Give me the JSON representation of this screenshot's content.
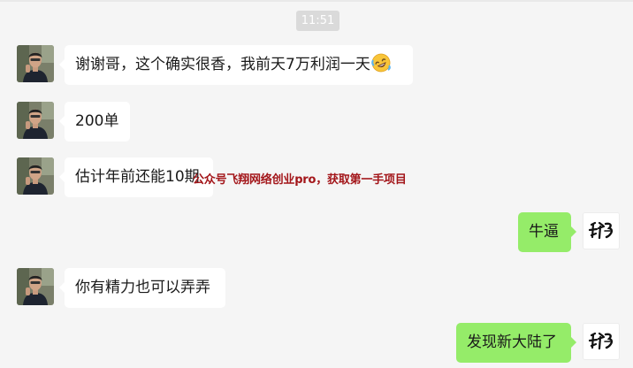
{
  "timestamp": "11:51",
  "messages": [
    {
      "side": "left",
      "text": "谢谢哥，这个确实很香，我前天7万利润一天",
      "emoji": "rolling-laughing-emoji"
    },
    {
      "side": "left",
      "text": "200单"
    },
    {
      "side": "left",
      "text": "估计年前还能10期"
    },
    {
      "side": "right",
      "text": "牛逼"
    },
    {
      "side": "left",
      "text": "你有精力也可以弄弄"
    },
    {
      "side": "right",
      "text": "发现新大陆了"
    }
  ],
  "watermark": "公众号飞翔网络创业pro，获取第一手项目",
  "colors": {
    "background": "#f5f5f5",
    "incoming_bubble": "#ffffff",
    "outgoing_bubble": "#95ec69",
    "timestamp_bg": "#dadada",
    "watermark": "#a3161a"
  },
  "icons": {
    "left_avatar": "person-photo-avatar",
    "right_avatar": "calligraphy-avatar",
    "emoji": "rolling-laughing-emoji"
  }
}
